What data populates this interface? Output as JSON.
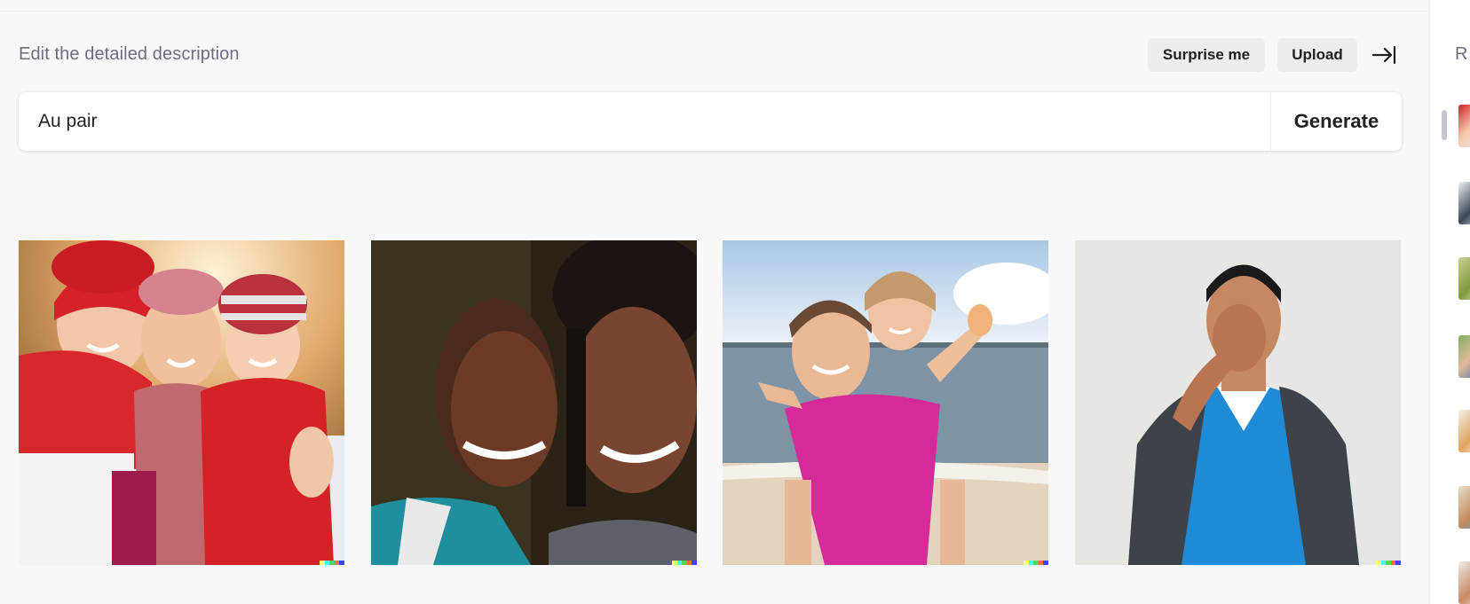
{
  "prompt": {
    "label": "Edit the detailed description",
    "value": "Au pair",
    "generate_label": "Generate"
  },
  "toolbar": {
    "surprise_label": "Surprise me",
    "upload_label": "Upload",
    "collapse_icon": "arrow-right-to-bar-icon"
  },
  "sidebar": {
    "title": "R"
  },
  "watermark_colors": [
    "#ffff66",
    "#42ffff",
    "#51da4c",
    "#ff6e3c",
    "#3c46ff"
  ],
  "colors": {
    "background": "#f8f8fa",
    "button_bg": "#ececf1",
    "text": "#202123",
    "muted": "#6e6e80"
  }
}
